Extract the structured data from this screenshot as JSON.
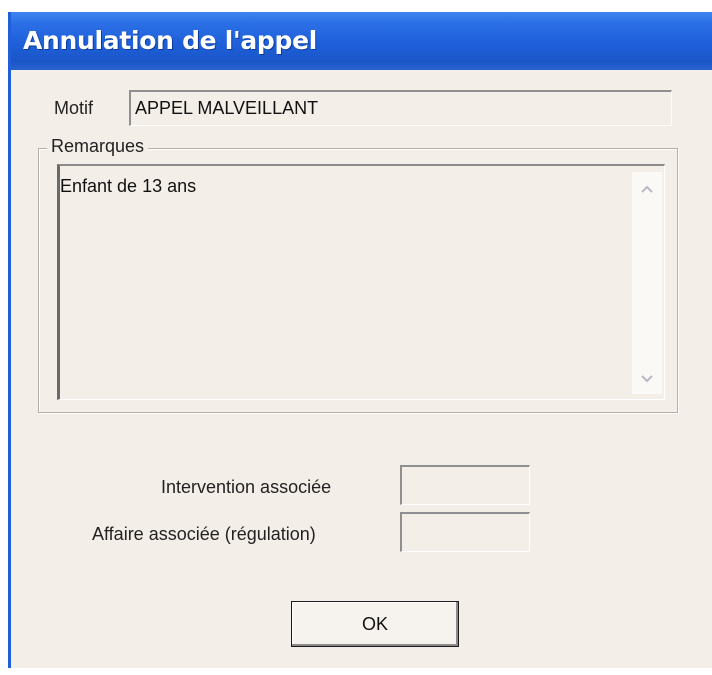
{
  "window": {
    "title": "Annulation de l'appel",
    "title_color": "#1e5fd9"
  },
  "motif": {
    "label": "Motif",
    "value": "APPEL MALVEILLANT"
  },
  "remarques": {
    "group_label": "Remarques",
    "text": "Enfant de 13 ans",
    "scroll_up_icon": "chevron-up-icon",
    "scroll_down_icon": "chevron-down-icon"
  },
  "intervention": {
    "label": "Intervention associée",
    "value": ""
  },
  "affaire": {
    "label": "Affaire associée (régulation)",
    "value": ""
  },
  "buttons": {
    "ok_label": "OK"
  }
}
